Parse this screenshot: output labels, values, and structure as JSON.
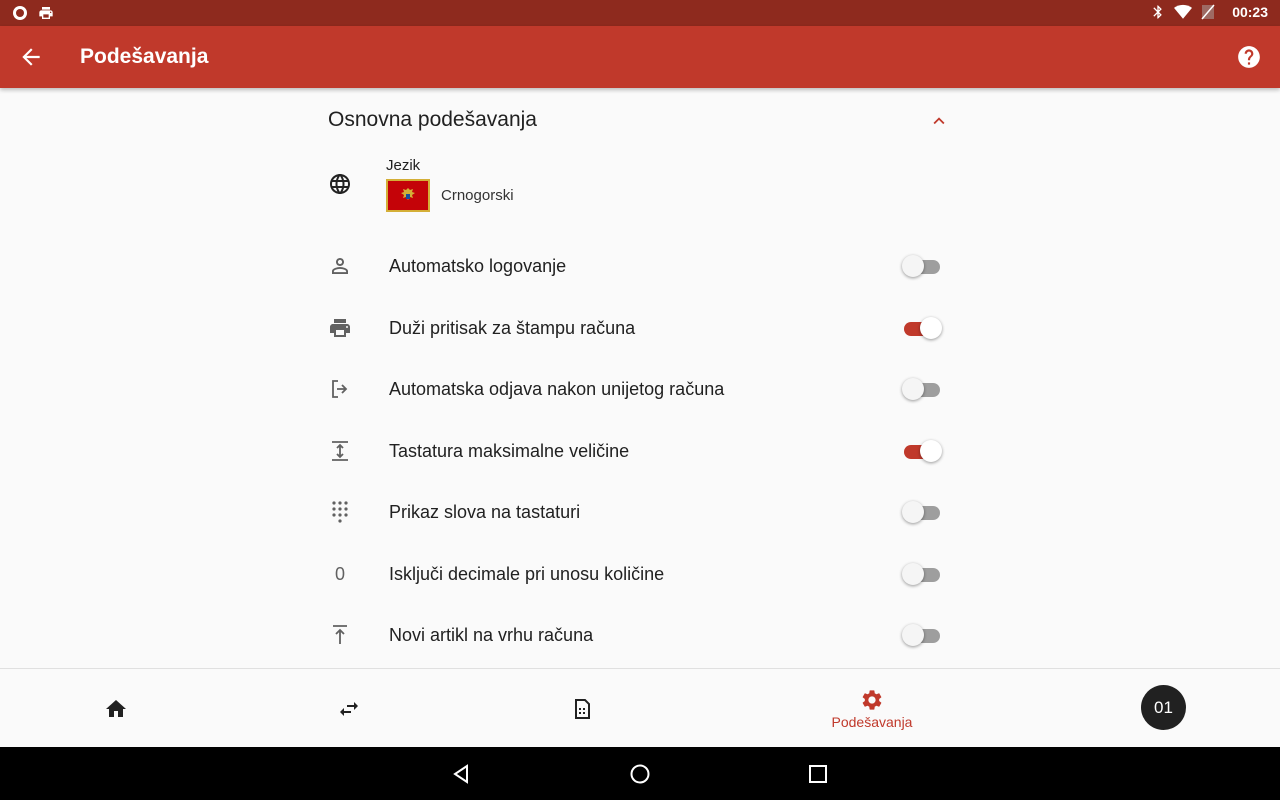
{
  "status_bar": {
    "time": "00:23",
    "icons": [
      "circle-notification-icon",
      "printer-notification-icon",
      "bluetooth-icon",
      "wifi-icon",
      "battery-icon"
    ]
  },
  "app_bar": {
    "title": "Podešavanja",
    "back_icon": "arrow-back-icon",
    "help_icon": "help-icon",
    "background": "#c0392b"
  },
  "section": {
    "title": "Osnovna podešavanja",
    "collapse_icon": "chevron-up-icon"
  },
  "language": {
    "label": "Jezik",
    "value": "Crnogorski",
    "icon": "globe-icon",
    "flag": "montenegro-flag"
  },
  "settings": [
    {
      "icon": "person-icon",
      "label": "Automatsko logovanje",
      "on": false
    },
    {
      "icon": "printer-icon",
      "label": "Duži pritisak za štampu računa",
      "on": true
    },
    {
      "icon": "logout-icon",
      "label": "Automatska odjava nakon unijetog računa",
      "on": false
    },
    {
      "icon": "expand-vertical-icon",
      "label": "Tastatura maksimalne veličine",
      "on": true
    },
    {
      "icon": "dialpad-icon",
      "label": "Prikaz slova na tastaturi",
      "on": false
    },
    {
      "icon": "zero-icon",
      "label": "Isključi decimale pri unosu količine",
      "on": false
    },
    {
      "icon": "arrow-to-top-icon",
      "label": "Novi artikl na vrhu računa",
      "on": false
    }
  ],
  "zero_glyph": "0",
  "bottom_nav": {
    "items": [
      {
        "icon": "home-icon",
        "label": ""
      },
      {
        "icon": "swap-icon",
        "label": ""
      },
      {
        "icon": "receipt-icon",
        "label": ""
      },
      {
        "icon": "settings-icon",
        "label": "Podešavanja",
        "active": true
      }
    ],
    "avatar_text": "01"
  },
  "colors": {
    "accent": "#c0392b",
    "status_bar": "#8e2a1e"
  }
}
